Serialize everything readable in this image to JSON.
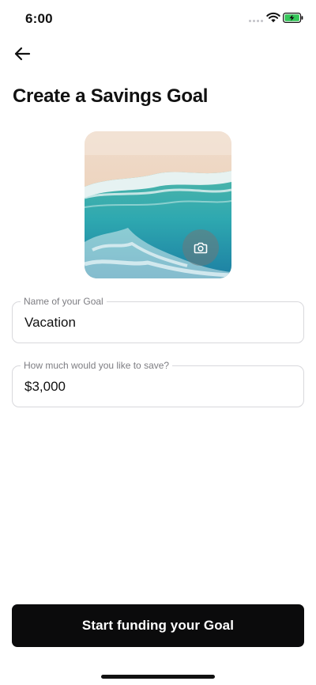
{
  "status_bar": {
    "time": "6:00",
    "signal_icon": "cellular-signal-icon",
    "wifi_icon": "wifi-icon",
    "battery_icon": "battery-charging-icon",
    "battery_color": "#34c759"
  },
  "header": {
    "back_icon": "arrow-left-icon",
    "title": "Create a Savings Goal"
  },
  "goal_image": {
    "camera_icon": "camera-icon"
  },
  "form": {
    "name_field": {
      "label": "Name of your Goal",
      "value": "Vacation"
    },
    "amount_field": {
      "label": "How much would you like to save?",
      "value": "$3,000"
    }
  },
  "cta": {
    "label": "Start funding your Goal",
    "color": "#0b0b0c"
  }
}
